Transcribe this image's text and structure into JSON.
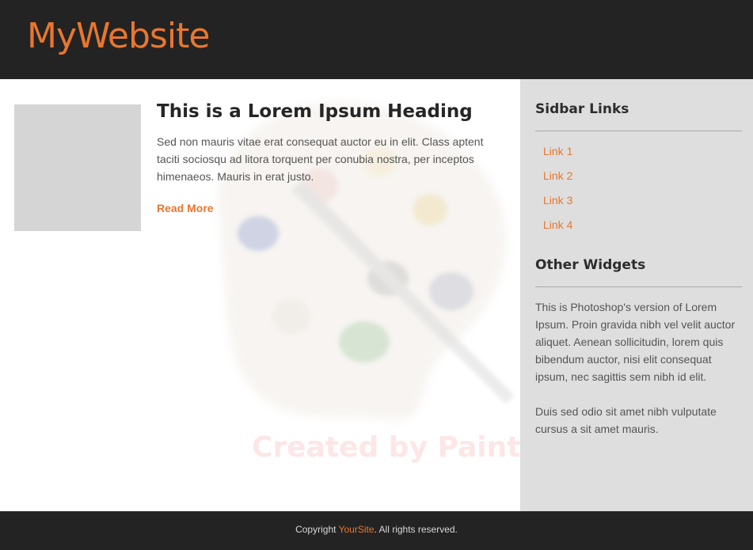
{
  "header": {
    "logo": "MyWebsite"
  },
  "post": {
    "title": "This is a Lorem Ipsum  Heading",
    "body": "Sed non  mauris vitae erat consequat auctor eu in elit. Class aptent taciti sociosqu ad litora torquent per conubia nostra, per inceptos himenaeos. Mauris in erat justo.",
    "read_more": "Read More"
  },
  "watermark": {
    "text": "Created by Paint S"
  },
  "sidebar": {
    "links_heading": "Sidbar Links",
    "links": [
      "Link 1",
      "Link 2",
      "Link 3",
      "Link 4"
    ],
    "widgets_heading": "Other Widgets",
    "paragraph1": "This is Photoshop's version  of Lorem Ipsum. Proin gravida nibh vel velit auctor aliquet. Aenean sollicitudin, lorem quis bibendum auctor, nisi elit consequat ipsum, nec sagittis sem nibh id elit.",
    "paragraph2": "Duis sed odio sit amet nibh vulputate cursus a sit amet mauris."
  },
  "footer": {
    "prefix": "Copyright ",
    "site_link": "YourSite",
    "suffix": ". All rights reserved."
  },
  "colors": {
    "accent": "#e8772e",
    "header_bg": "#232323",
    "sidebar_bg": "#dedede",
    "placeholder": "#d5d5d5"
  }
}
